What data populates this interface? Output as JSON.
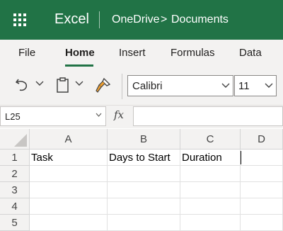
{
  "app": {
    "name": "Excel",
    "breadcrumb": [
      "OneDrive",
      "Documents"
    ],
    "breadcrumb_separator": ">"
  },
  "ribbon": {
    "tabs": [
      "File",
      "Home",
      "Insert",
      "Formulas",
      "Data"
    ],
    "active_tab": "Home",
    "font_name": "Calibri",
    "font_size": "11"
  },
  "formula_bar": {
    "name_box": "L25",
    "fx_label": "fx",
    "formula": ""
  },
  "sheet": {
    "columns": [
      "A",
      "B",
      "C",
      "D"
    ],
    "rows": [
      "1",
      "2",
      "3",
      "4",
      "5"
    ],
    "cells": {
      "A1": "Task",
      "B1": "Days to Start",
      "C1": "Duration"
    }
  },
  "colors": {
    "brand": "#217346",
    "ribbon_bg": "#f3f2f1"
  },
  "icons": [
    "app-launcher-icon",
    "undo-icon",
    "clipboard-icon",
    "format-painter-icon",
    "chevron-down-icon",
    "fx-icon"
  ]
}
